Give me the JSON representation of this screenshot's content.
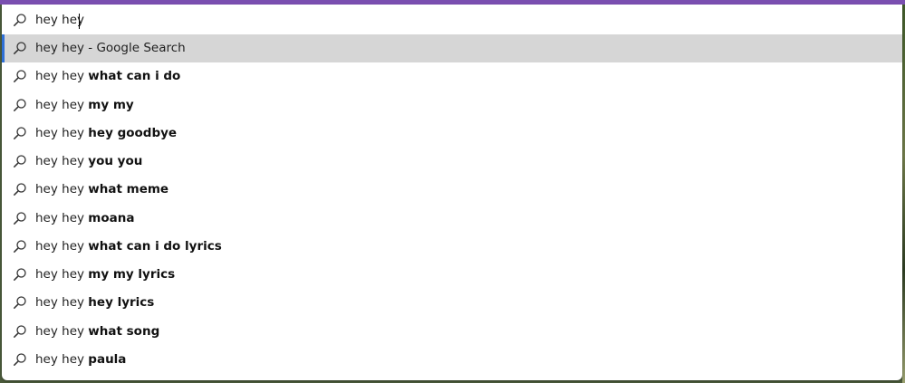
{
  "search": {
    "value": "hey hey",
    "icon": "search-icon"
  },
  "suggestions": [
    {
      "prefix": "hey hey",
      "completion": " - Google Search",
      "bold": false
    },
    {
      "prefix": "hey hey",
      "completion": "what can i do",
      "bold": true
    },
    {
      "prefix": "hey hey",
      "completion": "my my",
      "bold": true
    },
    {
      "prefix": "hey hey",
      "completion": "hey goodbye",
      "bold": true
    },
    {
      "prefix": "hey hey",
      "completion": "you you",
      "bold": true
    },
    {
      "prefix": "hey hey",
      "completion": "what meme",
      "bold": true
    },
    {
      "prefix": "hey hey",
      "completion": "moana",
      "bold": true
    },
    {
      "prefix": "hey hey",
      "completion": "what can i do lyrics",
      "bold": true
    },
    {
      "prefix": "hey hey",
      "completion": "my my lyrics",
      "bold": true
    },
    {
      "prefix": "hey hey",
      "completion": "hey lyrics",
      "bold": true
    },
    {
      "prefix": "hey hey",
      "completion": "what song",
      "bold": true
    },
    {
      "prefix": "hey hey",
      "completion": "paula",
      "bold": true
    }
  ],
  "colors": {
    "accent": "#7a4fb0",
    "selected_bg": "#d6d6d6",
    "selected_marker": "#2f6fd6"
  }
}
